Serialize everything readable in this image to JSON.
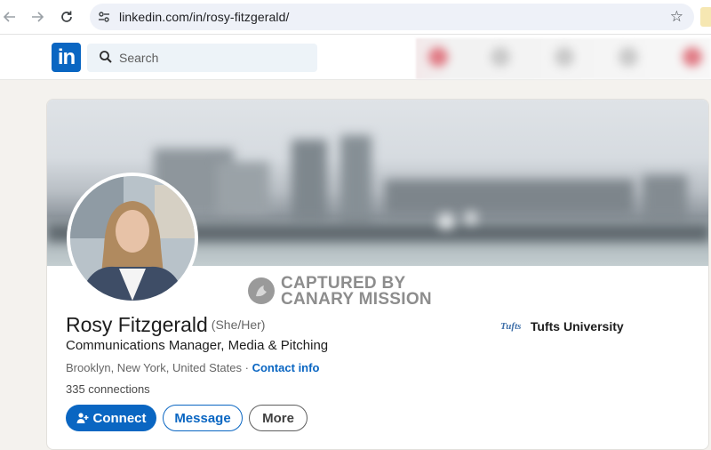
{
  "browser": {
    "url": "linkedin.com/in/rosy-fitzgerald/",
    "icons": [
      "back-arrow-icon",
      "forward-arrow-icon",
      "reload-icon",
      "site-settings-icon",
      "bookmark-star-icon"
    ]
  },
  "header": {
    "logo_text": "in",
    "search_placeholder": "Search"
  },
  "watermark": {
    "line1": "CAPTURED BY",
    "line2": "CANARY MISSION"
  },
  "profile": {
    "name": "Rosy Fitzgerald",
    "pronouns": "(She/Her)",
    "headline": "Communications Manager, Media & Pitching",
    "location": "Brooklyn, New York, United States",
    "separator": " · ",
    "contact_info": "Contact info",
    "connections": "335 connections",
    "education_logo": "Tufts",
    "education": "Tufts University"
  },
  "actions": {
    "connect": "Connect",
    "message": "Message",
    "more": "More"
  },
  "colors": {
    "brand": "#0a66c2",
    "background": "#f4f2ee"
  }
}
